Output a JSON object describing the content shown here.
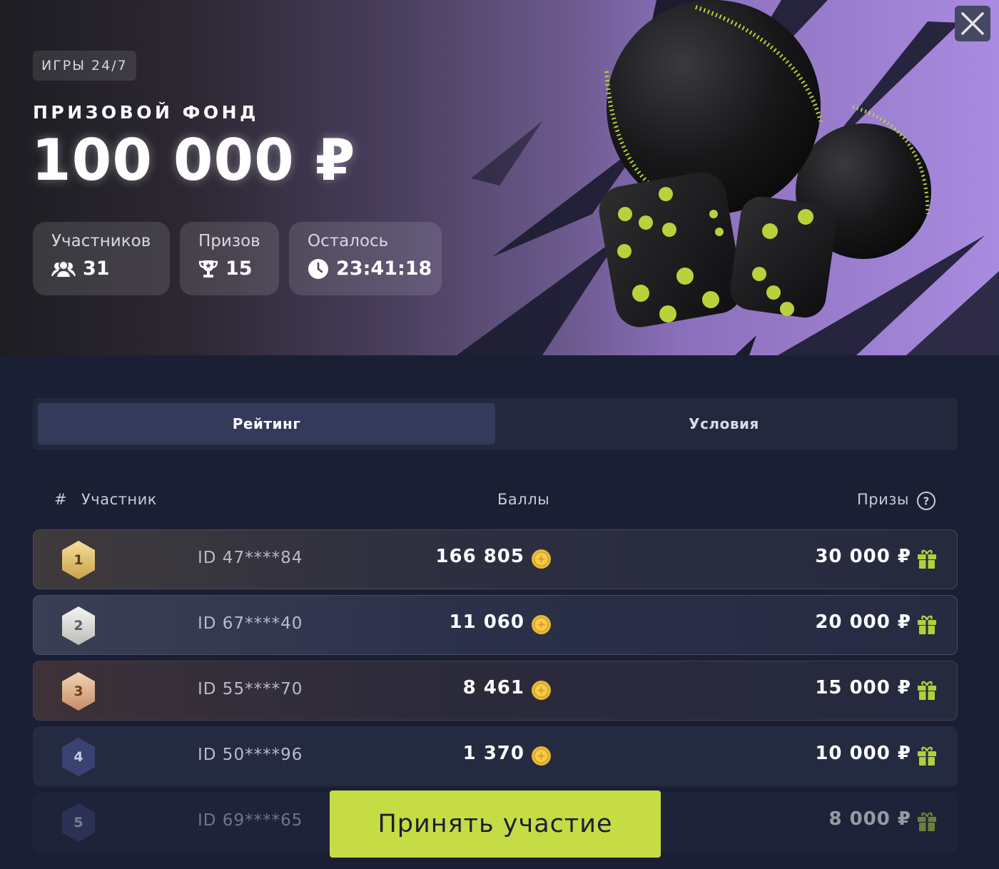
{
  "hero": {
    "tag": "ИГРЫ 24/7",
    "prize_label": "ПРИЗОВОЙ ФОНД",
    "prize_amount": "100 000 ₽",
    "stats": [
      {
        "label": "Участников",
        "value": "31",
        "icon": "users-icon"
      },
      {
        "label": "Призов",
        "value": "15",
        "icon": "trophy-icon"
      },
      {
        "label": "Осталось",
        "value": "23:41:18",
        "icon": "clock-icon"
      }
    ],
    "accent_color": "#c6dc45",
    "close_icon": "close-icon"
  },
  "tabs": [
    {
      "label": "Рейтинг",
      "active": true
    },
    {
      "label": "Условия",
      "active": false
    }
  ],
  "table": {
    "headers": {
      "num": "#",
      "participant": "Участник",
      "points": "Баллы",
      "prizes": "Призы",
      "help_icon": "question-circle-icon"
    },
    "rows": [
      {
        "rank": "1",
        "id": "ID 47****84",
        "points": "166 805",
        "prize": "30 000 ₽"
      },
      {
        "rank": "2",
        "id": "ID 67****40",
        "points": "11 060",
        "prize": "20 000 ₽"
      },
      {
        "rank": "3",
        "id": "ID 55****70",
        "points": "8 461",
        "prize": "15 000 ₽"
      },
      {
        "rank": "4",
        "id": "ID 50****96",
        "points": "1 370",
        "prize": "10 000 ₽"
      },
      {
        "rank": "5",
        "id": "ID 69****65",
        "points": "",
        "prize": "8 000 ₽"
      }
    ]
  },
  "cta": {
    "label": "Принять участие"
  }
}
